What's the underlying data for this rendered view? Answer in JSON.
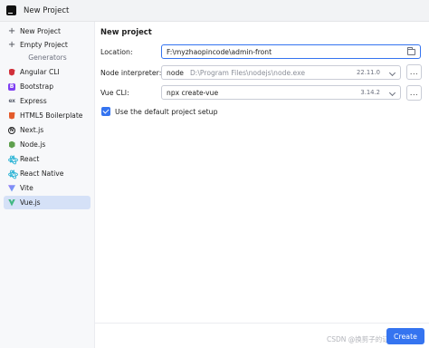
{
  "window": {
    "title": "New Project",
    "icon": "ide-logo-icon"
  },
  "sidebar": {
    "top_items": [
      {
        "label": "New Project",
        "icon": "plus-icon"
      },
      {
        "label": "Empty Project",
        "icon": "plus-icon"
      }
    ],
    "generators_label": "Generators",
    "generators": [
      {
        "label": "Angular CLI",
        "icon": "angular-icon"
      },
      {
        "label": "Bootstrap",
        "icon": "bootstrap-icon"
      },
      {
        "label": "Express",
        "icon": "express-icon"
      },
      {
        "label": "HTML5 Boilerplate",
        "icon": "html5-icon"
      },
      {
        "label": "Next.js",
        "icon": "nextjs-icon"
      },
      {
        "label": "Node.js",
        "icon": "nodejs-icon"
      },
      {
        "label": "React",
        "icon": "react-icon"
      },
      {
        "label": "React Native",
        "icon": "react-native-icon"
      },
      {
        "label": "Vite",
        "icon": "vite-icon"
      },
      {
        "label": "Vue.js",
        "icon": "vuejs-icon",
        "selected": true
      }
    ],
    "glyphs": {
      "plus": "+",
      "bootstrap": "B",
      "express": "ex",
      "next": "N"
    }
  },
  "form": {
    "heading": "New project",
    "location": {
      "label": "Location:",
      "value": "F:\\myzhaopincode\\admin-front"
    },
    "node_interpreter": {
      "label": "Node interpreter:",
      "name": "node",
      "path": "D:\\Program Files\\nodejs\\node.exe",
      "version": "22.11.0"
    },
    "vue_cli": {
      "label": "Vue CLI:",
      "value": "npx create-vue",
      "version": "3.14.2"
    },
    "browse_label": "...",
    "default_setup": {
      "label": "Use the default project setup",
      "checked": true
    }
  },
  "footer": {
    "watermark": "CSDN @换剪子的证书小说",
    "create_label": "Create"
  },
  "colors": {
    "accent": "#3574f0",
    "selection": "#d5e1f7",
    "sidebar_bg": "#f7f8fa"
  }
}
